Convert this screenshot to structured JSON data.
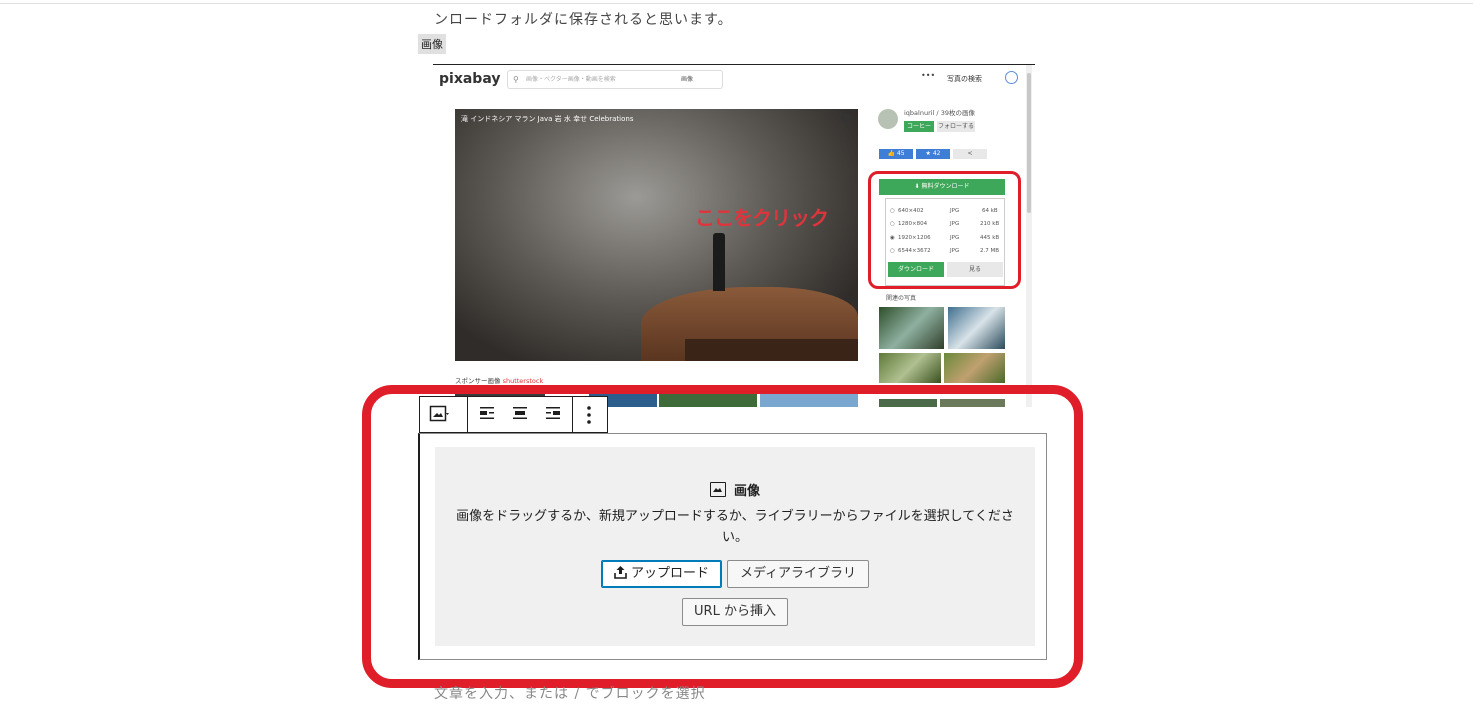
{
  "paragraph_text": "ンロードフォルダに保存されると思います。",
  "block_label": "画像",
  "embedded_screenshot": {
    "logo": "pixabay",
    "search_placeholder": "画像・ベクター画像・動画を検索",
    "search_type": "画像",
    "menu_dots": "•••",
    "explore_label": "写真の検索",
    "tags": "滝  インドネシア  マラン  Java  岩  水  幸せ  Celebrations",
    "annotation": "ここをクリック",
    "sponsor_label": "スポンサー画像",
    "sponsor_brand": "shutterstock",
    "user_text": "iqbalnuril / 39枚の画像",
    "coffee_label": "コーヒー",
    "follow_label": "フォローする",
    "like_count": "45",
    "fav_count": "42",
    "free_download_label": "無料ダウンロード",
    "sizes": [
      {
        "dim": "640×402",
        "fmt": "JPG",
        "size": "64 kB"
      },
      {
        "dim": "1280×804",
        "fmt": "JPG",
        "size": "210 kB"
      },
      {
        "dim": "1920×1206",
        "fmt": "JPG",
        "size": "445 kB"
      },
      {
        "dim": "6544×3672",
        "fmt": "JPG",
        "size": "2.7 MB"
      }
    ],
    "download_button": "ダウンロード",
    "view_button": "見る",
    "related_title": "関連の写真"
  },
  "placeholder": {
    "title": "画像",
    "description": "画像をドラッグするか、新規アップロードするか、ライブラリーからファイルを選択してください。",
    "upload_label": "アップロード",
    "media_library_label": "メディアライブラリ",
    "insert_url_label": "URL から挿入"
  },
  "next_block_placeholder": "文章を入力、または / でブロックを選択",
  "colors": {
    "highlight_red": "#e01e2a",
    "focus_blue": "#007cba",
    "pixabay_green": "#3ea85a"
  }
}
